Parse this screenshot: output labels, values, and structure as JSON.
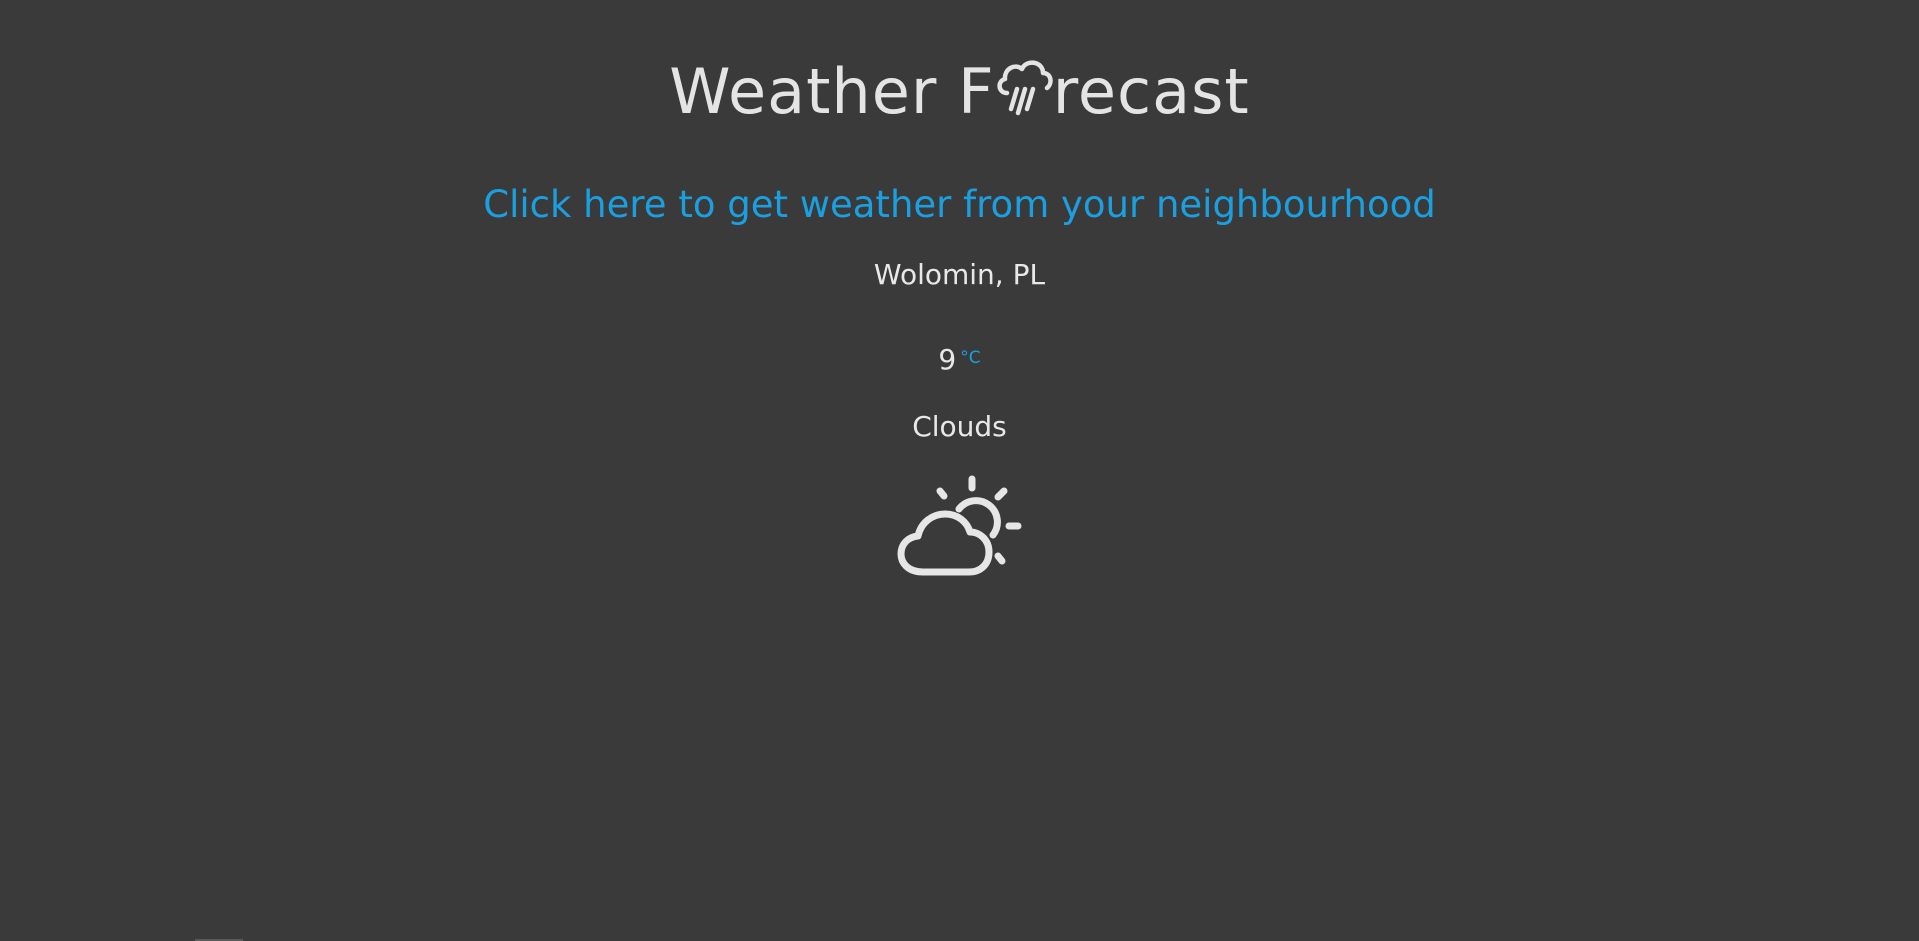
{
  "header": {
    "title_prefix": "Weather F",
    "title_suffix": "recast",
    "title_icon": "cloud-rain-icon"
  },
  "location_link": {
    "label": "Click here to get weather from your neighbourhood"
  },
  "weather": {
    "city": "Wolomin, PL",
    "temperature": "9",
    "unit": "°C",
    "description": "Clouds",
    "icon": "partly-cloudy-icon"
  },
  "colors": {
    "background": "#3a3a3a",
    "text": "#e8e8e8",
    "accent": "#1aa0e0"
  }
}
